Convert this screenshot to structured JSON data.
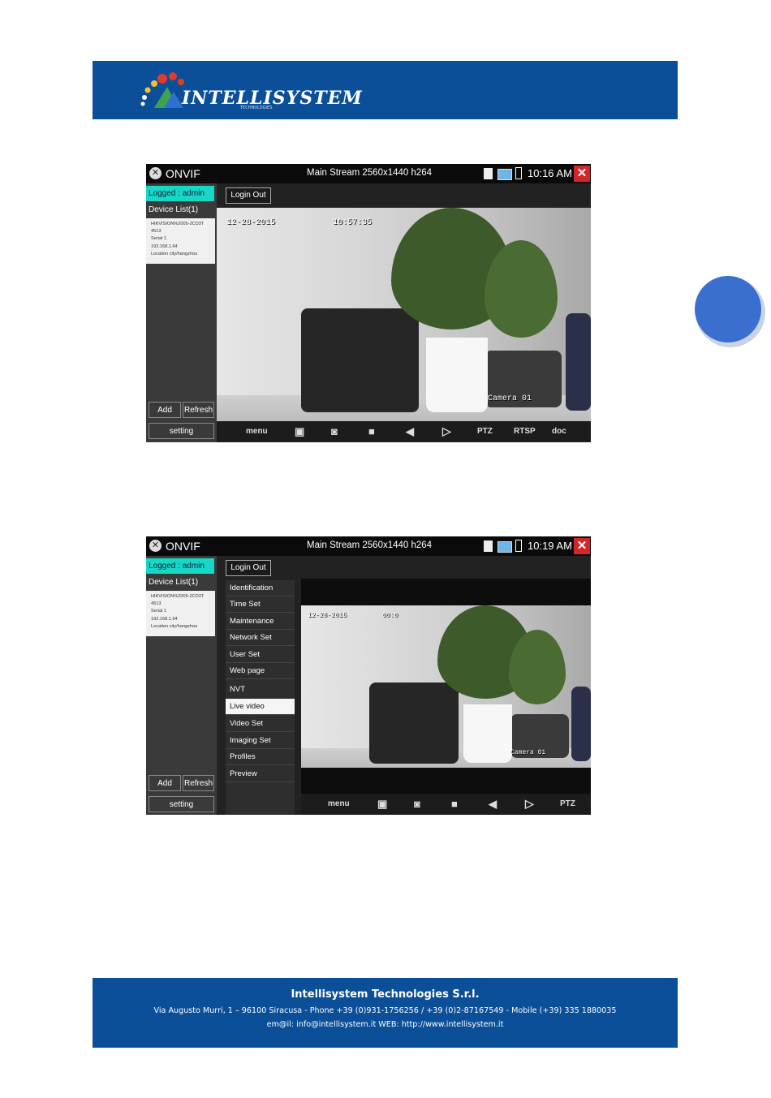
{
  "header": {
    "logo_text": "INTELLISYSTEM",
    "logo_subtext": "TECHNOLOGIES",
    "brand_color": "#0b4f98"
  },
  "screens": [
    {
      "app_title": "ONVIF",
      "stream_info": "Main Stream 2560x1440 h264",
      "clock": "10:16 AM",
      "logged": "Logged : admin",
      "login_out": "Login Out",
      "device_list_label": "Device List(1)",
      "device": [
        "HIKVISION%2005-2CD3T",
        "4513",
        "Serial 1",
        "192.168.1.64",
        "Location city/hangzhou"
      ],
      "add": "Add",
      "refresh": "Refresh",
      "setting": "setting",
      "overlay_date": "12-28-2015",
      "overlay_time": "10:57:35",
      "overlay_camera": "Camera 01",
      "toolbar": [
        "menu",
        "gallery-icon",
        "camera-icon",
        "record-icon",
        "mute-icon",
        "play-icon",
        "PTZ",
        "RTSP",
        "doc"
      ]
    },
    {
      "app_title": "ONVIF",
      "stream_info": "Main Stream 2560x1440 h264",
      "clock": "10:19 AM",
      "logged": "Logged : admin",
      "login_out": "Login Out",
      "device_list_label": "Device List(1)",
      "device": [
        "HIKVISION%2005-2CD3T",
        "4513",
        "Serial 1",
        "192.168.1.64",
        "Location city/hangzhou"
      ],
      "add": "Add",
      "refresh": "Refresh",
      "setting": "setting",
      "overlay_date": "12-28-2015",
      "overlay_time": "00:0",
      "overlay_camera": "Camera 01",
      "menu": [
        "Identification",
        "Time Set",
        "Maintenance",
        "Network Set",
        "User Set",
        "Web page",
        "NVT",
        "Live video",
        "Video Set",
        "Imaging Set",
        "Profiles",
        "Preview"
      ],
      "active_menu": "Live video",
      "toolbar": [
        "menu",
        "gallery-icon",
        "camera-icon",
        "record-icon",
        "mute-icon",
        "play-icon",
        "PTZ"
      ]
    }
  ],
  "footer": {
    "company": "Intellisystem Technologies S.r.l.",
    "address": "Via Augusto Murri, 1 – 96100 Siracusa - Phone +39 (0)931-1756256 / +39 (0)2-87167549 - Mobile (+39) 335 1880035",
    "contact": "em@il: info@intellisystem.it WEB: http://www.intellisystem.it"
  }
}
